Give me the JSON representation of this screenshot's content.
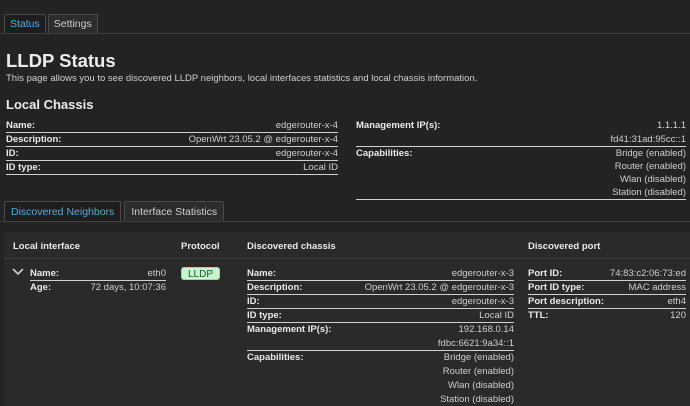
{
  "top_tabs": {
    "status": "Status",
    "settings": "Settings"
  },
  "page": {
    "title": "LLDP Status",
    "intro": "This page allows you to see discovered LLDP neighbors, local interfaces statistics and local chassis information."
  },
  "local_chassis": {
    "heading": "Local Chassis",
    "name_label": "Name:",
    "name": "edgerouter-x-4",
    "description_label": "Description:",
    "description": "OpenWrt 23.05.2 @ edgerouter-x-4",
    "id_label": "ID:",
    "id": "edgerouter-x-4",
    "id_type_label": "ID type:",
    "id_type": "Local ID",
    "mgmt_ip_label": "Management IP(s):",
    "mgmt_ip_1": "1.1.1.1",
    "mgmt_ip_2": "fd41:31ad:95cc::1",
    "capabilities_label": "Capabilities:",
    "cap_1": "Bridge (enabled)",
    "cap_2": "Router (enabled)",
    "cap_3": "Wlan (disabled)",
    "cap_4": "Station (disabled)"
  },
  "sub_tabs": {
    "neighbors": "Discovered Neighbors",
    "stats": "Interface Statistics"
  },
  "table": {
    "headers": {
      "local_interface": "Local interface",
      "protocol": "Protocol",
      "discovered_chassis": "Discovered chassis",
      "discovered_port": "Discovered port"
    },
    "row": {
      "name_label": "Name:",
      "name": "eth0",
      "age_label": "Age:",
      "age": "72 days, 10:07:36",
      "protocol": "LLDP",
      "chassis": {
        "name_label": "Name:",
        "name": "edgerouter-x-3",
        "description_label": "Description:",
        "description": "OpenWrt 23.05.2 @ edgerouter-x-3",
        "id_label": "ID:",
        "id": "edgerouter-x-3",
        "id_type_label": "ID type:",
        "id_type": "Local ID",
        "mgmt_ip_label": "Management IP(s):",
        "mgmt_ip_1": "192.168.0.14",
        "mgmt_ip_2": "fdbc:6621:9a34::1",
        "capabilities_label": "Capabilities:",
        "cap_1": "Bridge (enabled)",
        "cap_2": "Router (enabled)",
        "cap_3": "Wlan (disabled)",
        "cap_4": "Station (disabled)"
      },
      "port": {
        "id_label": "Port ID:",
        "id": "74:83:c2:06:73:ed",
        "id_type_label": "Port ID type:",
        "id_type": "MAC address",
        "description_label": "Port description:",
        "description": "eth4",
        "ttl_label": "TTL:",
        "ttl": "120"
      }
    }
  },
  "colors": {
    "background": "#232323",
    "accent": "#5aa9d6",
    "badge_bg": "#c9f2cf"
  },
  "icons": {
    "expand": "chevron-down-icon"
  }
}
